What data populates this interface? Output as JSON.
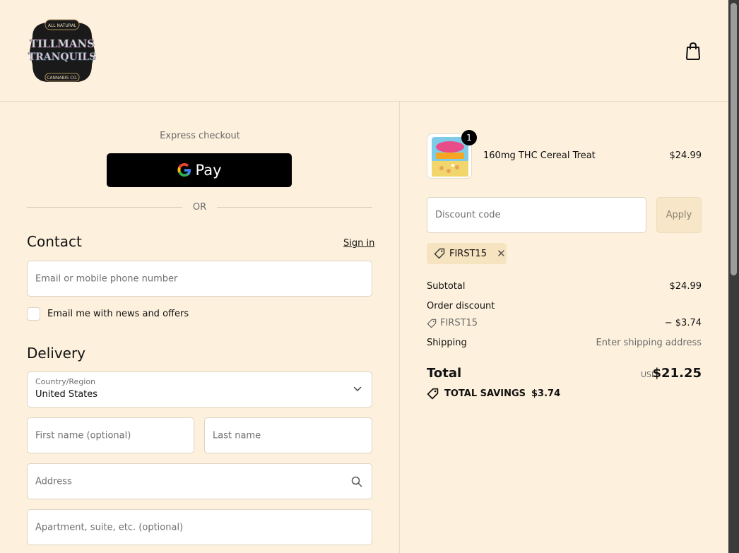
{
  "header": {
    "logo_text": {
      "top": "ALL NATURAL",
      "line1": "TILLMANS",
      "line2": "TRANQUILS",
      "bottom": "CANNABIS CO."
    },
    "cart_icon": "shopping-bag-icon"
  },
  "express": {
    "label": "Express checkout",
    "gpay_label": "Pay",
    "divider": "OR"
  },
  "contact": {
    "title": "Contact",
    "sign_in": "Sign in",
    "email_placeholder": "Email or mobile phone number",
    "newsletter_label": "Email me with news and offers"
  },
  "delivery": {
    "title": "Delivery",
    "country_label": "Country/Region",
    "country_value": "United States",
    "first_name_placeholder": "First name (optional)",
    "last_name_placeholder": "Last name",
    "address_placeholder": "Address",
    "apartment_placeholder": "Apartment, suite, etc. (optional)"
  },
  "summary": {
    "product": {
      "name": "160mg THC Cereal Treat",
      "price": "$24.99",
      "quantity": "1"
    },
    "discount_placeholder": "Discount code",
    "apply_label": "Apply",
    "applied_code": "FIRST15",
    "subtotal_label": "Subtotal",
    "subtotal_value": "$24.99",
    "order_discount_label": "Order discount",
    "discount_code": "FIRST15",
    "discount_value": "− $3.74",
    "shipping_label": "Shipping",
    "shipping_value": "Enter shipping address",
    "total_label": "Total",
    "total_currency": "USD",
    "total_value": "$21.25",
    "savings_label": "TOTAL SAVINGS",
    "savings_value": "$3.74"
  },
  "colors": {
    "background": "#fdf1dd",
    "apply_bg": "#f7e6c7",
    "tag_bg": "#f6e3bf"
  }
}
